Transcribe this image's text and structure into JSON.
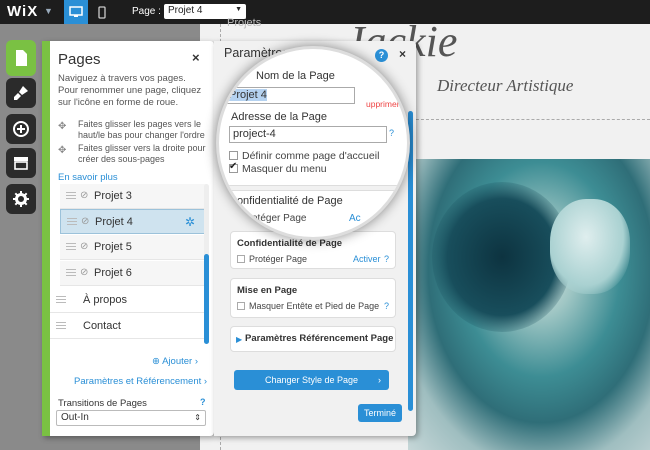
{
  "topbar": {
    "logo": "WiX",
    "page_label": "Page :",
    "page_select": "Projet 4"
  },
  "site": {
    "nav_fragment": "Projets",
    "title_fragment": "Jackie",
    "subtitle": "Directeur Artistique"
  },
  "pages_panel": {
    "title": "Pages",
    "close": "×",
    "description": "Naviguez à travers vos pages. Pour renommer une page, cliquez sur l'icône en forme de roue.",
    "hint1": "Faites glisser les pages vers le haut/le bas pour changer l'ordre",
    "hint2": "Faites glisser vers la droite pour créer des sous-pages",
    "learn_more": "En savoir plus",
    "items": [
      {
        "label": "Projet 3"
      },
      {
        "label": "Projet 4"
      },
      {
        "label": "Projet 5"
      },
      {
        "label": "Projet 6"
      },
      {
        "label": "À propos"
      },
      {
        "label": "Contact"
      }
    ],
    "add_label": "Ajouter",
    "seo_label": "Paramètres et Référencement",
    "transitions_label": "Transitions de Pages",
    "transitions_help": "?",
    "transitions_value": "Out-In"
  },
  "settings_panel": {
    "title": "Paramètres et",
    "help": "?",
    "close": "×",
    "confidentiality": {
      "title": "Confidentialité de Page",
      "option": "Protéger Page",
      "activate": "Activer",
      "help": "?"
    },
    "layout": {
      "title": "Mise en Page",
      "option": "Masquer Entête et Pied de Page",
      "help": "?"
    },
    "seo_section": "Paramètres Référencement Page",
    "change_style": "Changer Style de Page",
    "done": "Terminé"
  },
  "magnifier": {
    "page_name_label": "Nom de la Page",
    "page_name_value": "Projet 4",
    "delete_fragment": "upprimer",
    "address_label": "Adresse de la Page",
    "address_value": "project-4",
    "set_home": "Définir comme page d'accueil",
    "hide_menu": "Masquer du menu",
    "confidentiality_title": "Confidentialité de Page",
    "protect": "Protéger Page",
    "activate_fragment": "Ac",
    "help": "?"
  },
  "colors": {
    "accent": "#2a8fd6",
    "brand_green": "#7ac143",
    "topbar": "#1d1d1d"
  }
}
